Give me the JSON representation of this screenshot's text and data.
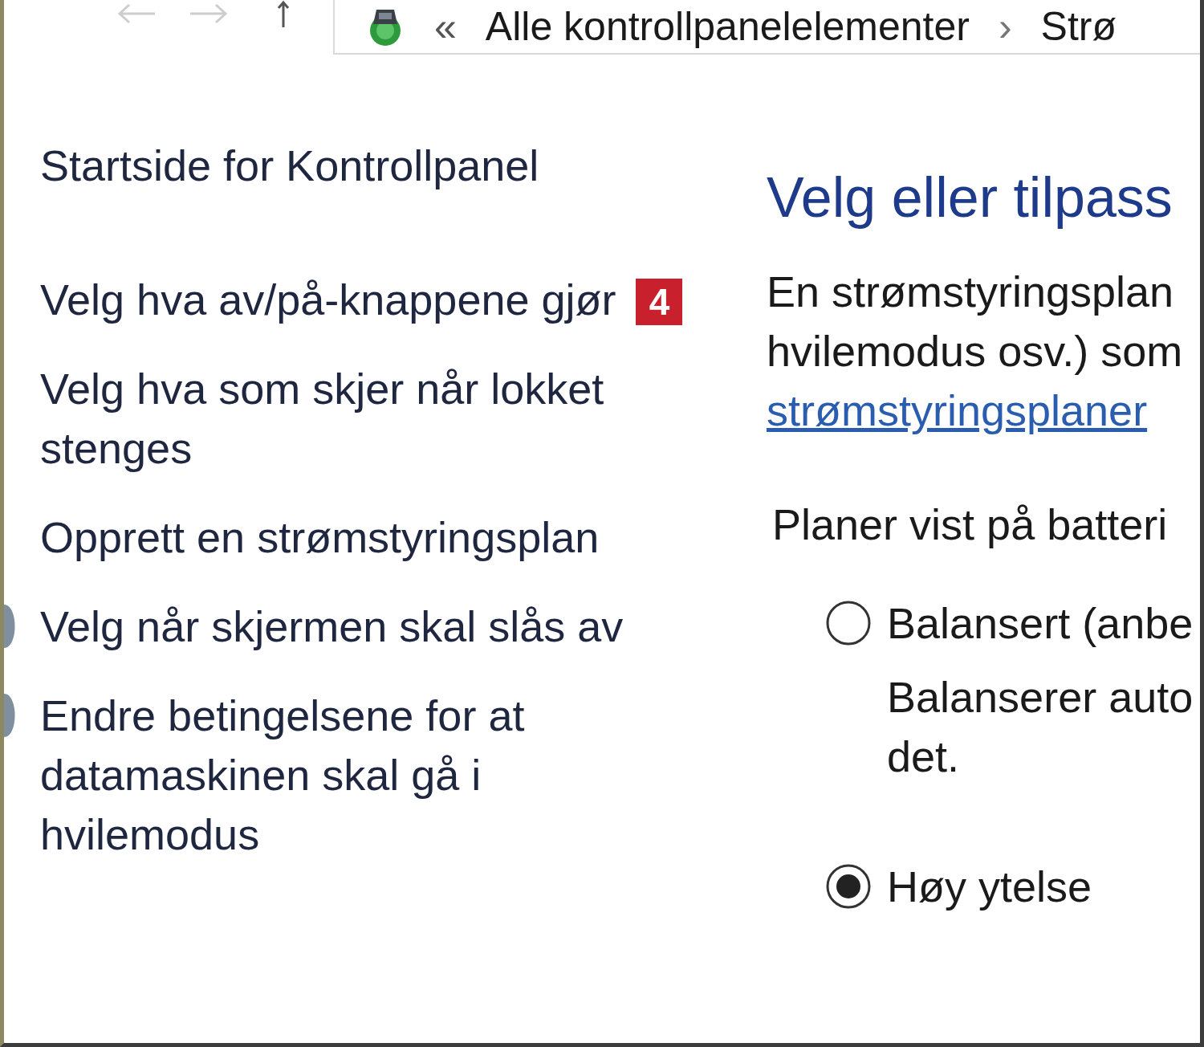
{
  "address_bar": {
    "items": [
      {
        "kind": "overflow",
        "label": "«"
      },
      {
        "kind": "crumb",
        "label": "Alle kontrollpanelelementer"
      },
      {
        "kind": "separator",
        "label": "›"
      },
      {
        "kind": "crumb",
        "label": "Strø"
      }
    ]
  },
  "sidebar": {
    "home_link": "Startside for Kontrollpanel",
    "items": [
      {
        "kind": "plain",
        "label": "Velg hva av/på-knappene gjør",
        "badge": "4"
      },
      {
        "kind": "plain",
        "label": "Velg hva som skjer når lokket stenges"
      },
      {
        "kind": "plain",
        "label": "Opprett en strømstyringsplan"
      },
      {
        "kind": "with-icon",
        "label": "Velg når skjermen skal slås av"
      },
      {
        "kind": "with-icon",
        "label": "Endre betingelsene for at datamaskinen skal gå i hvilemodus"
      }
    ]
  },
  "main": {
    "title": "Velg eller tilpass",
    "intro": {
      "lines": [
        "En strømstyringsplan",
        "hvilemodus osv.) som"
      ],
      "link": "strømstyringsplaner"
    },
    "plans": {
      "heading": "Planer vist på batteri",
      "items": [
        {
          "label": "Balansert (anbe",
          "description": [
            "Balanserer auto",
            "det."
          ],
          "selected": false
        },
        {
          "label": "Høy ytelse",
          "selected": true
        }
      ]
    }
  }
}
